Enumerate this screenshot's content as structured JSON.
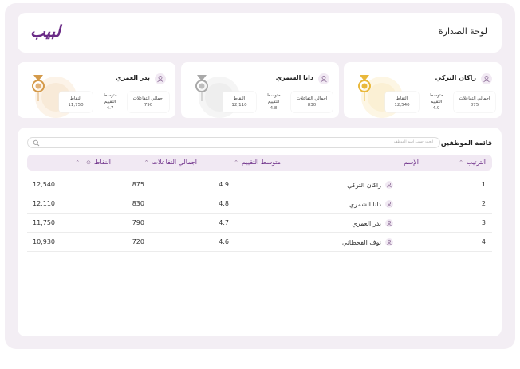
{
  "header": {
    "title": "لوحة الصدارة",
    "logo": "لبيب"
  },
  "top_cards": [
    {
      "name": "راكان التركي",
      "interactions_label": "اجمالي التفاعلات",
      "interactions": "875",
      "rating_label_1": "متوسط",
      "rating_label_2": "التقييم",
      "rating": "4.9",
      "points_label": "النقاط",
      "points": "12,540",
      "medal_color": "#e9b83b"
    },
    {
      "name": "دانا الشمري",
      "interactions_label": "اجمالي التفاعلات",
      "interactions": "830",
      "rating_label_1": "متوسط",
      "rating_label_2": "التقييم",
      "rating": "4.8",
      "points_label": "النقاط",
      "points": "12,110",
      "medal_color": "#a9a9a9"
    },
    {
      "name": "بدر العمري",
      "interactions_label": "اجمالي التفاعلات",
      "interactions": "790",
      "rating_label_1": "متوسط",
      "rating_label_2": "التقييم",
      "rating": "4.7",
      "points_label": "النقاط",
      "points": "11,750",
      "medal_color": "#d49a4a"
    }
  ],
  "employee_list": {
    "title": "قائمة الموظفين",
    "search_placeholder": "ابحث حسب اسم الموظف",
    "columns": {
      "rank": "الترتيب",
      "name": "الإسم",
      "rating": "متوسط التقييم",
      "interactions": "اجمالي التفاعلات",
      "points": "النقاط"
    },
    "rows": [
      {
        "rank": "1",
        "name": "راكان التركي",
        "rating": "4.9",
        "interactions": "875",
        "points": "12,540"
      },
      {
        "rank": "2",
        "name": "دانا الشمري",
        "rating": "4.8",
        "interactions": "830",
        "points": "12,110"
      },
      {
        "rank": "3",
        "name": "بدر العمري",
        "rating": "4.7",
        "interactions": "790",
        "points": "11,750"
      },
      {
        "rank": "4",
        "name": "نوف القحطاني",
        "rating": "4.6",
        "interactions": "720",
        "points": "10,930"
      }
    ]
  },
  "colors": {
    "accent": "#6a2a86",
    "background": "#f3eef4",
    "header_row": "#f1e9f3"
  }
}
